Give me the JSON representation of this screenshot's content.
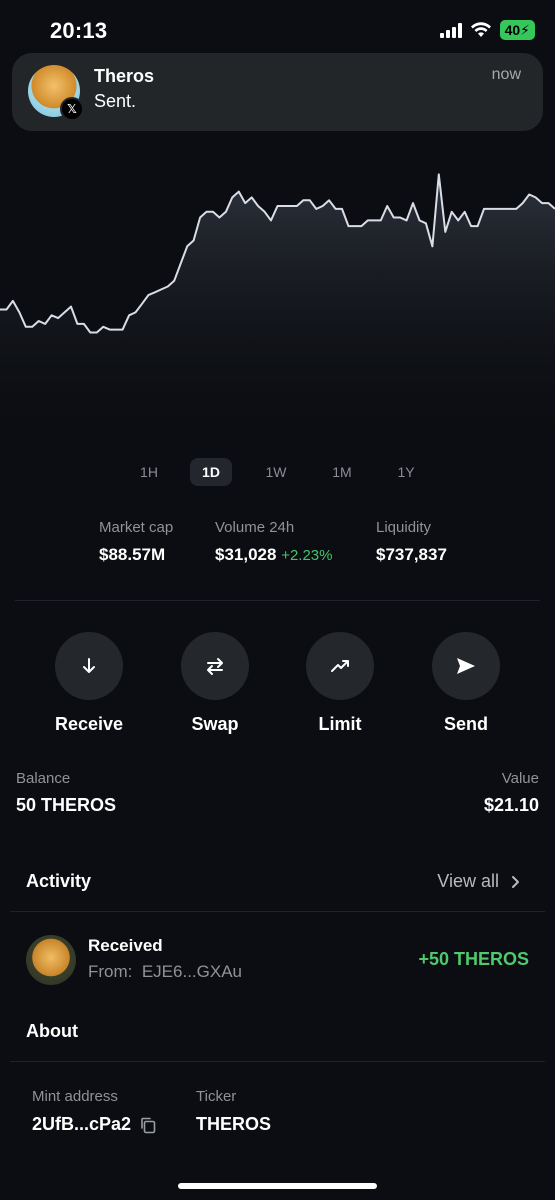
{
  "status_bar": {
    "time": "20:13",
    "battery": "40"
  },
  "notification": {
    "title": "Theros",
    "body": "Sent.",
    "time": "now",
    "badge_icon": "x-logo-icon"
  },
  "chart_data": {
    "type": "area",
    "x": [
      0,
      1,
      2,
      3,
      4,
      5,
      6,
      7,
      8,
      9,
      10,
      11,
      12,
      13,
      14,
      15,
      16,
      17,
      18,
      19,
      20,
      21,
      22,
      23,
      24,
      25,
      26,
      27,
      28,
      29,
      30,
      31,
      32,
      33,
      34,
      35,
      36,
      37,
      38,
      39,
      40,
      41,
      42,
      43,
      44,
      45,
      46,
      47,
      48,
      49,
      50,
      51,
      52,
      53,
      54,
      55,
      56,
      57,
      58,
      59,
      60,
      61,
      62,
      63,
      64,
      65,
      66,
      67,
      68,
      69,
      70,
      71,
      72,
      73,
      74,
      75,
      76,
      77,
      78,
      79,
      80,
      81,
      82,
      83,
      84,
      85,
      86,
      87,
      88,
      89,
      90,
      91,
      92,
      93,
      94,
      95,
      96,
      97,
      98,
      99
    ],
    "values": [
      28,
      28,
      31,
      27,
      22,
      22,
      24,
      23,
      26,
      25,
      27,
      29,
      23,
      23,
      20,
      20,
      22,
      21,
      21,
      21,
      26,
      27,
      30,
      33,
      34,
      35,
      36,
      38,
      44,
      50,
      52,
      60,
      62,
      62,
      60,
      62,
      67,
      69,
      65,
      67,
      64,
      62,
      59,
      64,
      64,
      64,
      64,
      66,
      66,
      63,
      64,
      66,
      63,
      63,
      57,
      57,
      57,
      59,
      59,
      59,
      64,
      60,
      60,
      59,
      65,
      59,
      58,
      50,
      75,
      55,
      62,
      59,
      62,
      57,
      57,
      63,
      63,
      63,
      63,
      63,
      63,
      65,
      68,
      67,
      65,
      65,
      63
    ],
    "color": "#d9dde6",
    "grid": false,
    "ranges": [
      "1H",
      "1D",
      "1W",
      "1M",
      "1Y"
    ],
    "active_range": "1D"
  },
  "stats": [
    {
      "label": "Market cap",
      "value": "$88.57M"
    },
    {
      "label": "Volume 24h",
      "value": "$31,028",
      "change": "+2.23%"
    },
    {
      "label": "Liquidity",
      "value": "$737,837"
    }
  ],
  "actions": [
    {
      "label": "Receive",
      "icon": "arrow-down-icon"
    },
    {
      "label": "Swap",
      "icon": "swap-arrows-icon"
    },
    {
      "label": "Limit",
      "icon": "trend-up-icon"
    },
    {
      "label": "Send",
      "icon": "paper-plane-icon"
    }
  ],
  "balance": {
    "label": "Balance",
    "amount": "50 THEROS",
    "value_label": "Value",
    "value": "$21.10"
  },
  "activity": {
    "title": "Activity",
    "view_all": "View all",
    "item": {
      "title": "Received",
      "from_label": "From:",
      "from": "EJE6...GXAu",
      "amount": "+50 THEROS"
    }
  },
  "about": {
    "title": "About",
    "mint_label": "Mint address",
    "mint_value": "2UfB...cPa2",
    "ticker_label": "Ticker",
    "ticker_value": "THEROS"
  },
  "colors": {
    "background": "#0b0d12",
    "positive": "#45c46a",
    "battery": "#35c759"
  }
}
